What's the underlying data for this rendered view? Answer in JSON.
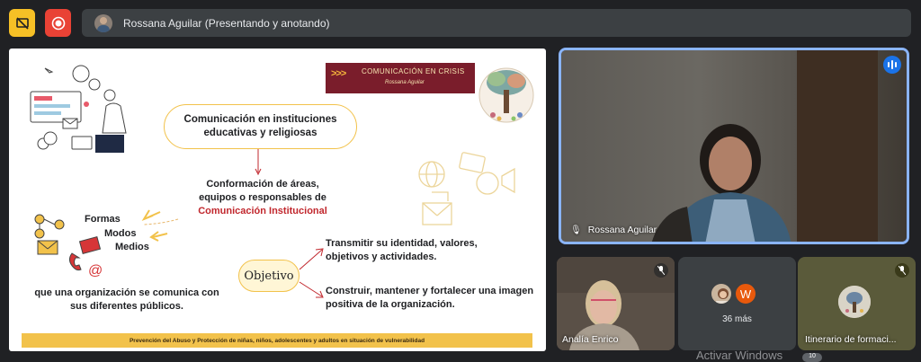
{
  "top_bar": {
    "presenter_label": "Rossana Aguilar (Presentando y anotando)"
  },
  "slide": {
    "banner_title": "COMUNICACIÓN EN CRISIS",
    "banner_author": "Rossana Aguilar",
    "banner_arrows": ">>>",
    "main_bubble": "Comunicación en instituciones educativas y religiosas",
    "conformacion_line1": "Conformación de áreas,",
    "conformacion_line2": "equipos o responsables de",
    "comunicacion_institucional": "Comunicación Institucional",
    "formas": "Formas",
    "modos": "Modos",
    "medios": "Medios",
    "objetivo": "Objetivo",
    "transmitir": "Transmitir su identidad, valores, objetivos y actividades.",
    "construir": "Construir, mantener y fortalecer una imagen positiva de la organización.",
    "organizacion": "que una organización se comunica con sus diferentes públicos.",
    "footer": "Prevención del Abuso y Protección de niñas, niños, adolescentes  y  adultos en situación de vulnerabilidad"
  },
  "main_video": {
    "name": "Rossana Aguilar"
  },
  "tiles": [
    {
      "name": "Analía Enrico",
      "muted": true
    },
    {
      "name": "36 más",
      "avatar_letter": "W"
    },
    {
      "name": "Itinerario de formaci...",
      "muted": true
    }
  ],
  "watermark": {
    "text": "Activar Windows",
    "badge": "10"
  },
  "colors": {
    "background": "#202124",
    "accent_blue": "#1a73e8",
    "banner": "#7a1d2b",
    "slide_yellow": "#f2c24b",
    "institucional_red": "#c1272d"
  }
}
